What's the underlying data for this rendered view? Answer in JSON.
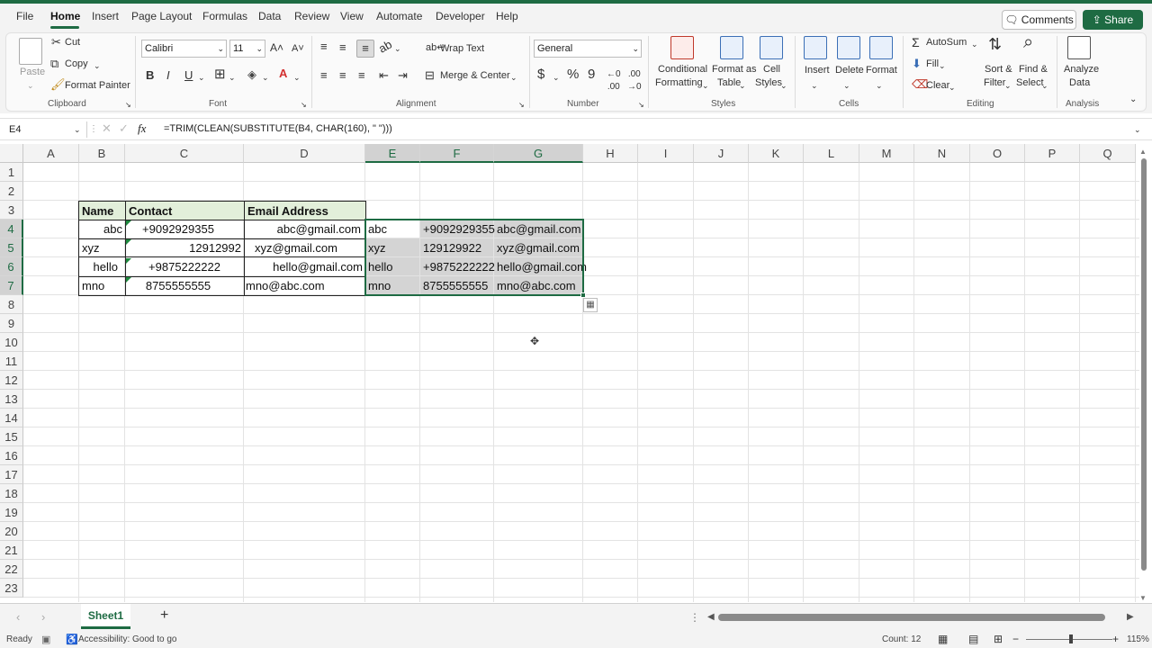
{
  "menu": {
    "tabs": [
      "File",
      "Home",
      "Insert",
      "Page Layout",
      "Formulas",
      "Data",
      "Review",
      "View",
      "Automate",
      "Developer",
      "Help"
    ],
    "comments": "Comments",
    "share": "Share"
  },
  "ribbon": {
    "clipboard": {
      "paste": "Paste",
      "cut": "Cut",
      "copy": "Copy",
      "format_painter": "Format Painter",
      "label": "Clipboard"
    },
    "font": {
      "name": "Calibri",
      "size": "11",
      "bold": "B",
      "italic": "I",
      "underline": "U",
      "label": "Font"
    },
    "alignment": {
      "wrap_text": "Wrap Text",
      "merge_center": "Merge & Center",
      "label": "Alignment"
    },
    "number": {
      "format": "General",
      "label": "Number"
    },
    "styles": {
      "conditional": "Conditional",
      "formatting": "Formatting",
      "format_as": "Format as",
      "table": "Table",
      "cell": "Cell",
      "styles": "Styles",
      "label": "Styles"
    },
    "cells": {
      "insert": "Insert",
      "delete": "Delete",
      "format": "Format",
      "label": "Cells"
    },
    "editing": {
      "autosum": "AutoSum",
      "fill": "Fill",
      "clear": "Clear",
      "sort": "Sort &",
      "filter": "Filter",
      "find": "Find &",
      "select": "Select",
      "label": "Editing"
    },
    "analysis": {
      "analyze": "Analyze",
      "data": "Data",
      "label": "Analysis"
    }
  },
  "formula_bar": {
    "name_box": "E4",
    "fx": "fx",
    "formula": "=TRIM(CLEAN(SUBSTITUTE(B4, CHAR(160), \" \")))"
  },
  "grid": {
    "columns": [
      "A",
      "B",
      "C",
      "D",
      "E",
      "F",
      "G",
      "H",
      "I",
      "J",
      "K",
      "L",
      "M",
      "N",
      "O",
      "P",
      "Q"
    ],
    "rows": [
      "1",
      "2",
      "3",
      "4",
      "5",
      "6",
      "7",
      "8",
      "9",
      "10",
      "11",
      "12",
      "13",
      "14",
      "15",
      "16",
      "17",
      "18",
      "19",
      "20",
      "21",
      "22",
      "23"
    ],
    "headers": [
      "Name",
      "Contact",
      "Email Address"
    ],
    "source": [
      {
        "name": "abc",
        "contact": "+9092929355",
        "email": "abc@gmail.com"
      },
      {
        "name": "xyz",
        "contact": "12912992",
        "email": "xyz@gmail.com"
      },
      {
        "name": "hello",
        "contact": "+9875222222",
        "email": "hello@gmail.com"
      },
      {
        "name": "mno",
        "contact": "8755555555",
        "email": "mno@abc.com"
      }
    ],
    "cleaned": [
      {
        "name": "abc",
        "contact": "+9092929355",
        "email": "abc@gmail.com"
      },
      {
        "name": "xyz",
        "contact": "129129922",
        "email": "xyz@gmail.com"
      },
      {
        "name": "hello",
        "contact": "+9875222222",
        "email": "hello@gmail.com"
      },
      {
        "name": "mno",
        "contact": "8755555555",
        "email": "mno@abc.com"
      }
    ]
  },
  "sheets": {
    "active": "Sheet1",
    "add": "+"
  },
  "status": {
    "ready": "Ready",
    "accessibility": "Accessibility: Good to go",
    "count": "Count: 12",
    "zoom": "115%"
  },
  "colors": {
    "accent": "#1e6b43",
    "header_fill": "#e2efda",
    "selection": "#d4d4d4"
  }
}
